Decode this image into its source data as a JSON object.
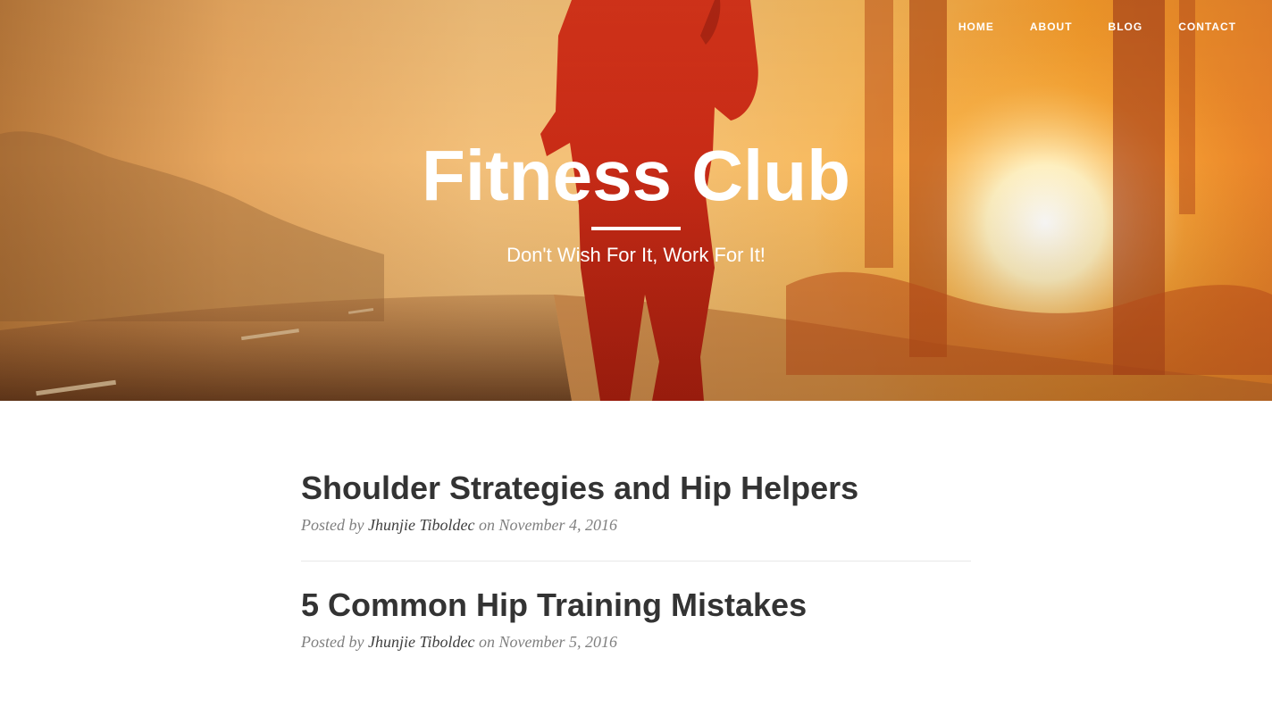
{
  "nav": {
    "items": [
      {
        "label": "HOME"
      },
      {
        "label": "ABOUT"
      },
      {
        "label": "BLOG"
      },
      {
        "label": "CONTACT"
      }
    ]
  },
  "header": {
    "title": "Fitness Club",
    "subtitle": "Don't Wish For It, Work For It!"
  },
  "posts": [
    {
      "title": "Shoulder Strategies and Hip Helpers",
      "posted_by": "Posted by",
      "author": "Jhunjie Tiboldec",
      "on": "on",
      "date": "November 4, 2016"
    },
    {
      "title": "5 Common Hip Training Mistakes",
      "posted_by": "Posted by",
      "author": "Jhunjie Tiboldec",
      "on": "on",
      "date": "November 5, 2016"
    }
  ],
  "colors": {
    "accent_text": "#333333",
    "meta_text": "#808080",
    "hero_warm": "#f59a2a"
  }
}
